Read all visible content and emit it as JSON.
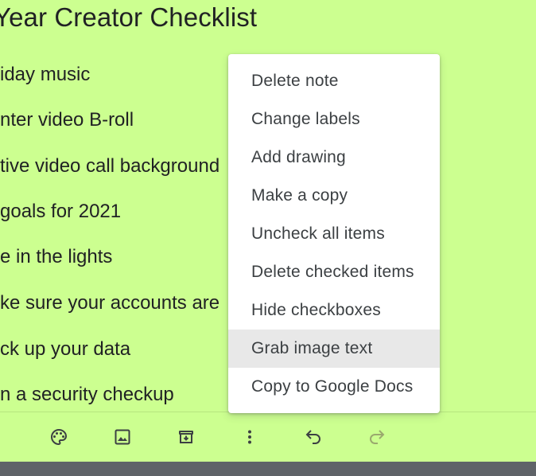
{
  "note": {
    "title": "Year Creator Checklist",
    "background_color": "#ccff90",
    "items": [
      "iday music",
      "nter video B-roll",
      "tive video call background",
      " goals for 2021",
      "e in the lights",
      "ke sure your accounts are",
      "ck up your data",
      "n a security checkup"
    ]
  },
  "menu": {
    "items": [
      "Delete note",
      "Change labels",
      "Add drawing",
      "Make a copy",
      "Uncheck all items",
      "Delete checked items",
      "Hide checkboxes",
      "Grab image text",
      "Copy to Google Docs"
    ],
    "highlighted_item": "Grab image text"
  },
  "toolbar": {
    "icons": [
      "add-person-icon",
      "palette-icon",
      "image-icon",
      "archive-icon",
      "more-vert-icon",
      "undo-icon",
      "redo-icon"
    ],
    "redo_disabled": true
  }
}
